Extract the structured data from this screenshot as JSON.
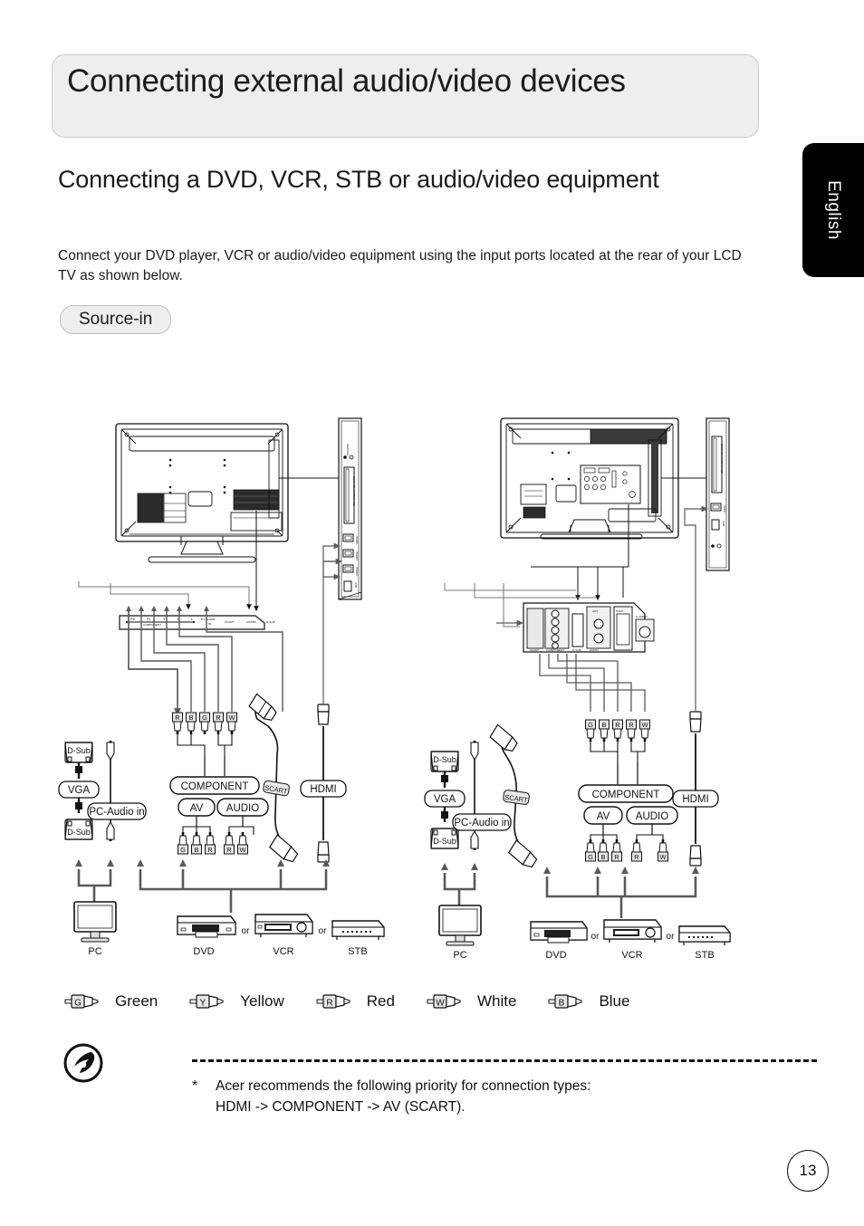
{
  "document": {
    "banner_title": "Connecting external audio/video devices",
    "language_tab": "English",
    "section_heading": "Connecting a DVD, VCR, STB or audio/video equipment",
    "intro_paragraph": "Connect your DVD player, VCR or audio/video equipment using the input ports located at the rear of your LCD TV as shown below.",
    "source_pill": "Source-in",
    "page_number": "13"
  },
  "note": {
    "star": "*",
    "line1": "Acer recommends the following priority for connection types:",
    "line2": "HDMI -> COMPONENT -> AV (SCART)."
  },
  "legend": {
    "items": [
      {
        "code": "G",
        "label": "Green"
      },
      {
        "code": "Y",
        "label": "Yellow"
      },
      {
        "code": "R",
        "label": "Red"
      },
      {
        "code": "W",
        "label": "White"
      },
      {
        "code": "B",
        "label": "Blue"
      }
    ]
  },
  "diagram_left": {
    "rear_panel_labels": [
      "Pb",
      "Pr",
      "Y",
      "R",
      "L",
      "PC-AUDIO IN",
      "SCART",
      "ANT/RF",
      "D-SUB"
    ],
    "component_group_label": "COMPONENT",
    "side_panel_labels": [
      "SERVICE",
      "COMMON INTERFACE",
      "HDMI1",
      "HDMI2",
      "HDMI3",
      "USB"
    ],
    "cable_boxes": {
      "dsub_top": "D-Sub",
      "dsub_bottom": "D-Sub",
      "vga": "VGA",
      "pc_audio": "PC-Audio in",
      "component": "COMPONENT",
      "av": "AV",
      "audio": "AUDIO",
      "scart": "SCART",
      "hdmi": "HDMI"
    },
    "rca_top": [
      "R",
      "B",
      "G",
      "R",
      "W"
    ],
    "rca_bottom": [
      "G",
      "B",
      "R",
      "R",
      "W"
    ],
    "devices": [
      {
        "name": "PC"
      },
      {
        "name": "DVD"
      },
      {
        "name": "VCR"
      },
      {
        "name": "STB"
      }
    ],
    "or_label": "or"
  },
  "diagram_right": {
    "rear_panel_labels": [
      "SCART",
      "COMPONENT",
      "PC IN",
      "ANT",
      "HDMI",
      "S-VIDEO",
      "AUDIO"
    ],
    "side_panel_labels": [
      "COMMON INTERFACE",
      "HDMI",
      "USB"
    ],
    "cable_boxes": {
      "dsub_top": "D-Sub",
      "dsub_bottom": "D-Sub",
      "vga": "VGA",
      "pc_audio": "PC-Audio in",
      "component": "COMPONENT",
      "av": "AV",
      "audio": "AUDIO",
      "scart": "SCART",
      "hdmi": "HDMI"
    },
    "rca_top": [
      "G",
      "B",
      "R",
      "R",
      "W"
    ],
    "rca_bottom": [
      "G",
      "B",
      "R",
      "R",
      "W"
    ],
    "devices": [
      {
        "name": "PC"
      },
      {
        "name": "DVD"
      },
      {
        "name": "VCR"
      },
      {
        "name": "STB"
      }
    ],
    "or_label": "or"
  },
  "colors": {
    "banner_bg": "#eeeeee",
    "banner_border": "#c9c9c9",
    "tab_bg": "#000000",
    "line": "#111111",
    "arrow": "#595959"
  }
}
